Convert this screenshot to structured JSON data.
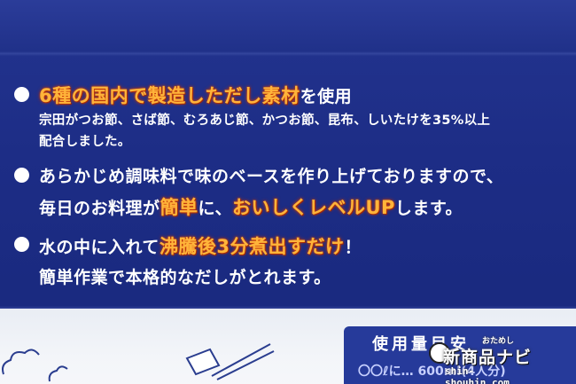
{
  "features": [
    {
      "main_highlight": "6種の国内で製造しただし素材",
      "main_rest": "を使用",
      "sub_line1": "宗田がつお節、さば節、むろあじ節、かつお節、昆布、しいたけを35%以上",
      "sub_line2": "配合しました。"
    },
    {
      "line1": "あらかじめ調味料で味のベースを作り上げておりますので、",
      "line2_a": "毎日のお料理が",
      "line2_hl1": "簡単",
      "line2_b": "に、",
      "line2_hl2": "おいしくレベルUP",
      "line2_c": "します。"
    },
    {
      "line1_a": "水の中に入れて",
      "line1_hl": "沸騰後3分煮出すだけ",
      "line1_b": "！",
      "line2": "簡単作業で本格的なだしがとれます。"
    }
  ],
  "usage_box": {
    "title": "使用量目安",
    "partial_text": "〇〇ℓに…  600ml(4人分)"
  },
  "watermark": {
    "small": "おためし",
    "brand": "新商品ナビ",
    "url": "shin-shouhin.com"
  }
}
